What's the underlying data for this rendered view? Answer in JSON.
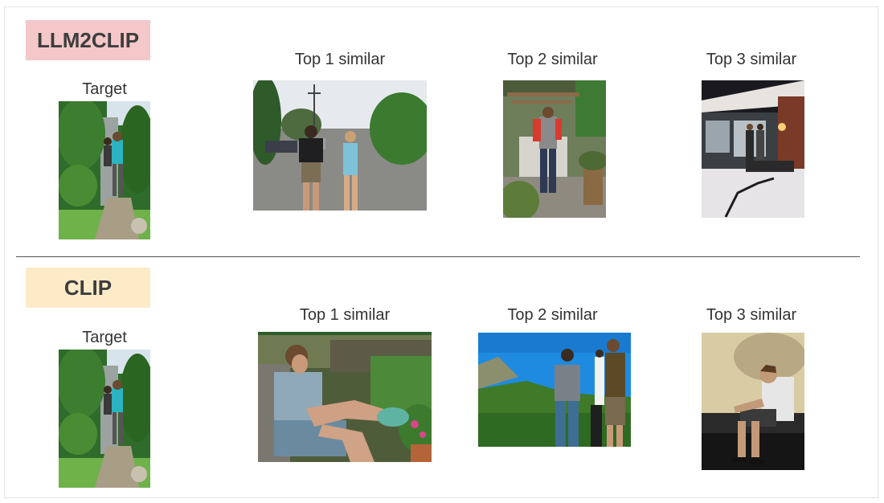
{
  "rows": [
    {
      "method": "LLM2CLIP",
      "badge_color": "#f4c7c9",
      "target_label": "Target",
      "results": [
        {
          "label": "Top 1 similar",
          "scene": "two people standing on a street"
        },
        {
          "label": "Top 2 similar",
          "scene": "man in red sleeves under a pergola"
        },
        {
          "label": "Top 3 similar",
          "scene": "two people at a house doorway at night in snow"
        }
      ]
    },
    {
      "method": "CLIP",
      "badge_color": "#fdebc8",
      "target_label": "Target",
      "results": [
        {
          "label": "Top 1 similar",
          "scene": "young man sitting in a chair by plants"
        },
        {
          "label": "Top 2 similar",
          "scene": "three people on a grassy hill under blue sky"
        },
        {
          "label": "Top 3 similar",
          "scene": "man sitting on a step against a beige wall"
        }
      ]
    }
  ],
  "colors": {
    "divider": "#555555",
    "text": "#333333"
  }
}
